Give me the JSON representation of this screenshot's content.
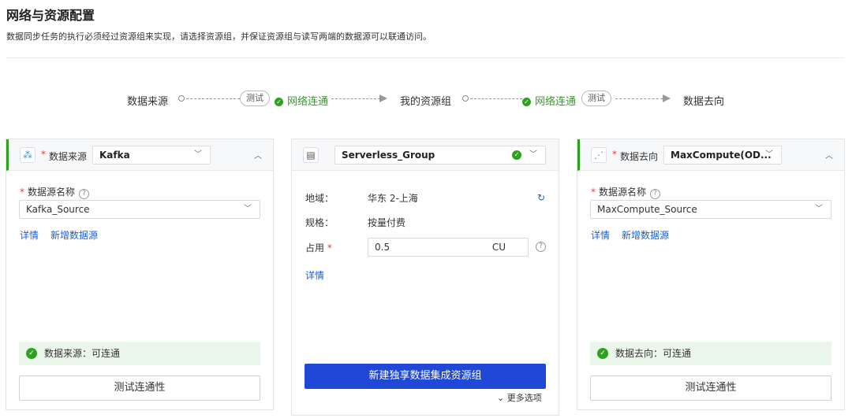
{
  "page": {
    "title": "网络与资源配置",
    "description": "数据同步任务的执行必须经过资源组来实现，请选择资源组，并保证资源组与读写两端的数据源可以联通访问。"
  },
  "flow": {
    "source_label": "数据来源",
    "test_label_1": "测试",
    "network_ok_1": "网络连通",
    "resource_group_label": "我的资源组",
    "network_ok_2": "网络连通",
    "test_label_2": "测试",
    "dest_label": "数据去向"
  },
  "source_card": {
    "type_label": "数据来源",
    "type_value": "Kafka",
    "name_label": "数据源名称",
    "name_value": "Kafka_Source",
    "detail_link": "详情",
    "add_link": "新增数据源",
    "status_text": "数据来源：可连通",
    "test_button": "测试连通性"
  },
  "resource_card": {
    "group_value": "Serverless_Group",
    "region_key": "地域：",
    "region_value": "华东 2-上海",
    "spec_key": "规格：",
    "spec_value": "按量付费",
    "usage_key": "占用",
    "usage_value": "0.5",
    "usage_unit": "CU",
    "detail_link": "详情",
    "create_button": "新建独享数据集成资源组",
    "more_options": "更多选项"
  },
  "dest_card": {
    "type_label": "数据去向",
    "type_value": "MaxCompute(OD...",
    "name_label": "数据源名称",
    "name_value": "MaxCompute_Source",
    "detail_link": "详情",
    "add_link": "新增数据源",
    "status_text": "数据去向：可连通",
    "test_button": "测试连通性"
  },
  "colors": {
    "success": "#2ea121",
    "primary": "#1f48d6",
    "link": "#1a5fd8",
    "required": "#e23c39"
  }
}
